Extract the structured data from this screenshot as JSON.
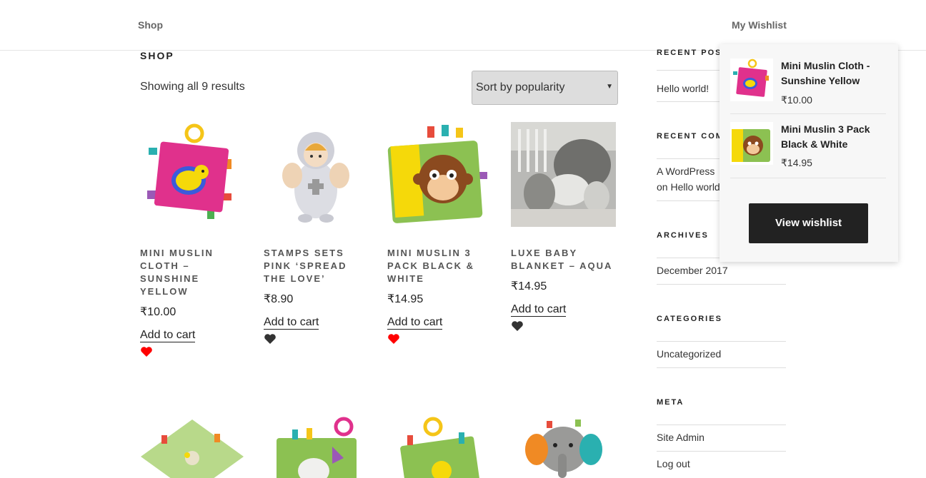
{
  "nav": {
    "shop": "Shop",
    "wishlist": "My Wishlist"
  },
  "page": {
    "title": "SHOP",
    "result_count": "Showing all 9 results",
    "sort_value": "Sort by popularity"
  },
  "products": [
    {
      "title": "Mini Muslin Cloth – Sunshine Yellow",
      "price": "₹10.00",
      "add": "Add to cart",
      "wishlisted": true,
      "image": "crinkle-tag-toy-pink-icon"
    },
    {
      "title": "Stamps Sets Pink ‘Spread the Love’",
      "price": "₹8.90",
      "add": "Add to cart",
      "wishlisted": false,
      "image": "angel-plush-icon"
    },
    {
      "title": "Mini Muslin 3 Pack Black & White",
      "price": "₹14.95",
      "add": "Add to cart",
      "wishlisted": true,
      "image": "monkey-book-icon"
    },
    {
      "title": "Luxe Baby Blanket – Aqua",
      "price": "₹14.95",
      "add": "Add to cart",
      "wishlisted": false,
      "image": "nursery-photo-icon"
    }
  ],
  "sidebar": {
    "recent_posts_title": "RECENT POS",
    "recent_post": "Hello world!",
    "recent_comments_title": "RECENT COM",
    "comment_line1": "A WordPress",
    "comment_line2": "on Hello world",
    "archives_title": "ARCHIVES",
    "archive": "December 2017",
    "categories_title": "CATEGORIES",
    "category": "Uncategorized",
    "meta_title": "META",
    "meta_items": [
      "Site Admin",
      "Log out"
    ]
  },
  "wishlist_dropdown": {
    "items": [
      {
        "name": "Mini Muslin Cloth - Sunshine Yellow",
        "price": "₹10.00"
      },
      {
        "name": "Mini Muslin 3 Pack Black & White",
        "price": "₹14.95"
      }
    ],
    "button": "View wishlist"
  },
  "colors": {
    "heart_active": "#ff0000",
    "heart_inactive": "#333333",
    "button_bg": "#222222"
  }
}
